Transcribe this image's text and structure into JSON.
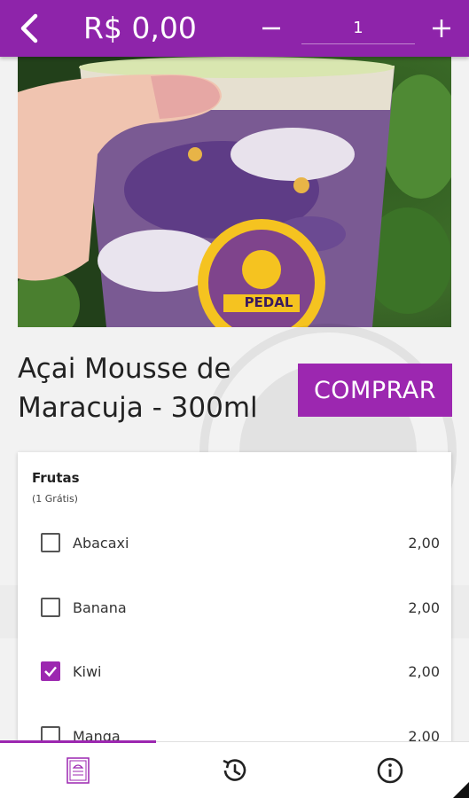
{
  "header": {
    "price": "R$ 0,00",
    "quantity": "1"
  },
  "product": {
    "title": "Açai Mousse de Maracuja - 300ml",
    "buy_label": "COMPRAR",
    "logo_text": "PEDAL"
  },
  "options_group": {
    "title": "Frutas",
    "subtitle": "(1 Grátis)",
    "items": [
      {
        "label": "Abacaxi",
        "price": "2,00",
        "checked": false
      },
      {
        "label": "Banana",
        "price": "2,00",
        "checked": false
      },
      {
        "label": "Kiwi",
        "price": "2,00",
        "checked": true
      },
      {
        "label": "Manga",
        "price": "2,00",
        "checked": false
      }
    ]
  },
  "bottom_nav": {
    "items": [
      {
        "icon": "menu-book-icon",
        "active": true
      },
      {
        "icon": "history-icon",
        "active": false
      },
      {
        "icon": "info-icon",
        "active": false
      }
    ]
  },
  "colors": {
    "brand": "#8e24aa",
    "accent": "#9c27b0"
  }
}
